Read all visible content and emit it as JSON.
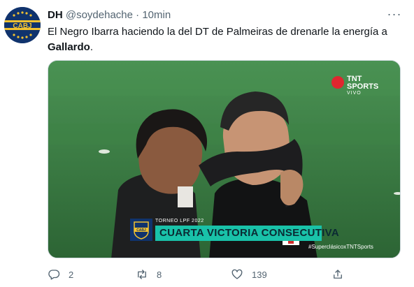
{
  "tweet": {
    "display_name": "DH",
    "handle": "@soydehache",
    "separator": "·",
    "time": "10min",
    "more_icon": "more-icon",
    "text_part1": "El Negro Ibarra haciendo la del DT de Palmeiras de drenarle la energía a ",
    "text_bold": "Gallardo",
    "text_part2": "."
  },
  "avatar": {
    "label": "CABJ",
    "colors": {
      "blue": "#10336d",
      "yellow": "#f2c230"
    }
  },
  "media": {
    "broadcaster_line1": "TNT",
    "broadcaster_line2": "SPORTS",
    "broadcaster_line3": "VIVO",
    "tournament": "TORNEO LPF 2022",
    "badge_label": "CABJ",
    "headline": "CUARTA VICTORIA CONSECUTIVA",
    "hashtag": "#SuperclásicoxTNTSports",
    "accent_color": "#19c2a9"
  },
  "actions": {
    "reply_count": "2",
    "retweet_count": "8",
    "like_count": "139",
    "share_label": ""
  }
}
